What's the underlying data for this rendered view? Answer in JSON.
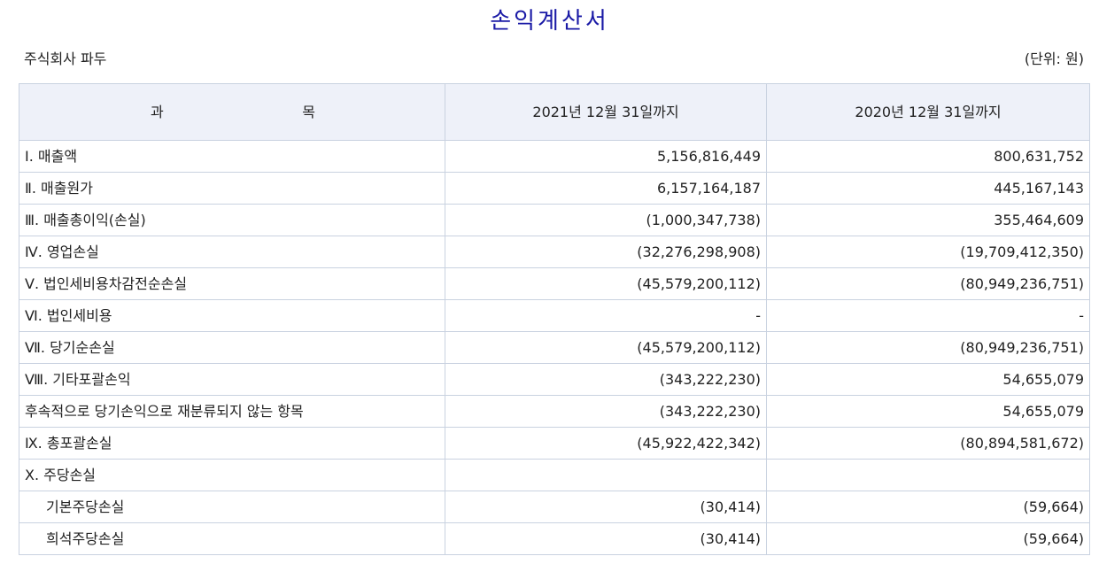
{
  "document": {
    "title": "손익계산서",
    "company": "주식회사 파두",
    "unit": "(단위: 원)"
  },
  "table": {
    "header": {
      "subject_left": "과",
      "subject_right": "목",
      "col_2021": "2021년 12월 31일까지",
      "col_2020": "2020년 12월 31일까지"
    },
    "rows": [
      {
        "label": "Ⅰ. 매출액",
        "v2021": "5,156,816,449",
        "v2020": "800,631,752"
      },
      {
        "label": "Ⅱ. 매출원가",
        "v2021": "6,157,164,187",
        "v2020": "445,167,143"
      },
      {
        "label": "Ⅲ. 매출총이익(손실)",
        "v2021": "(1,000,347,738)",
        "v2020": "355,464,609"
      },
      {
        "label": "Ⅳ. 영업손실",
        "v2021": "(32,276,298,908)",
        "v2020": "(19,709,412,350)"
      },
      {
        "label": "Ⅴ. 법인세비용차감전순손실",
        "v2021": "(45,579,200,112)",
        "v2020": "(80,949,236,751)"
      },
      {
        "label": "Ⅵ. 법인세비용",
        "v2021": "-",
        "v2020": "-"
      },
      {
        "label": "Ⅶ. 당기순손실",
        "v2021": "(45,579,200,112)",
        "v2020": "(80,949,236,751)"
      },
      {
        "label": "Ⅷ. 기타포괄손익",
        "v2021": "(343,222,230)",
        "v2020": "54,655,079"
      },
      {
        "label": "후속적으로 당기손익으로 재분류되지 않는 항목",
        "v2021": "(343,222,230)",
        "v2020": "54,655,079"
      },
      {
        "label": "Ⅸ. 총포괄손실",
        "v2021": "(45,922,422,342)",
        "v2020": "(80,894,581,672)"
      },
      {
        "label": "Ⅹ. 주당손실",
        "v2021": "",
        "v2020": ""
      },
      {
        "label": "기본주당손실",
        "v2021": "(30,414)",
        "v2020": "(59,664)"
      },
      {
        "label": "희석주당손실",
        "v2021": "(30,414)",
        "v2020": "(59,664)"
      }
    ]
  },
  "colors": {
    "title": "#1a1aa6",
    "header_bg": "#eef1f9",
    "border": "#c9d2e0"
  }
}
